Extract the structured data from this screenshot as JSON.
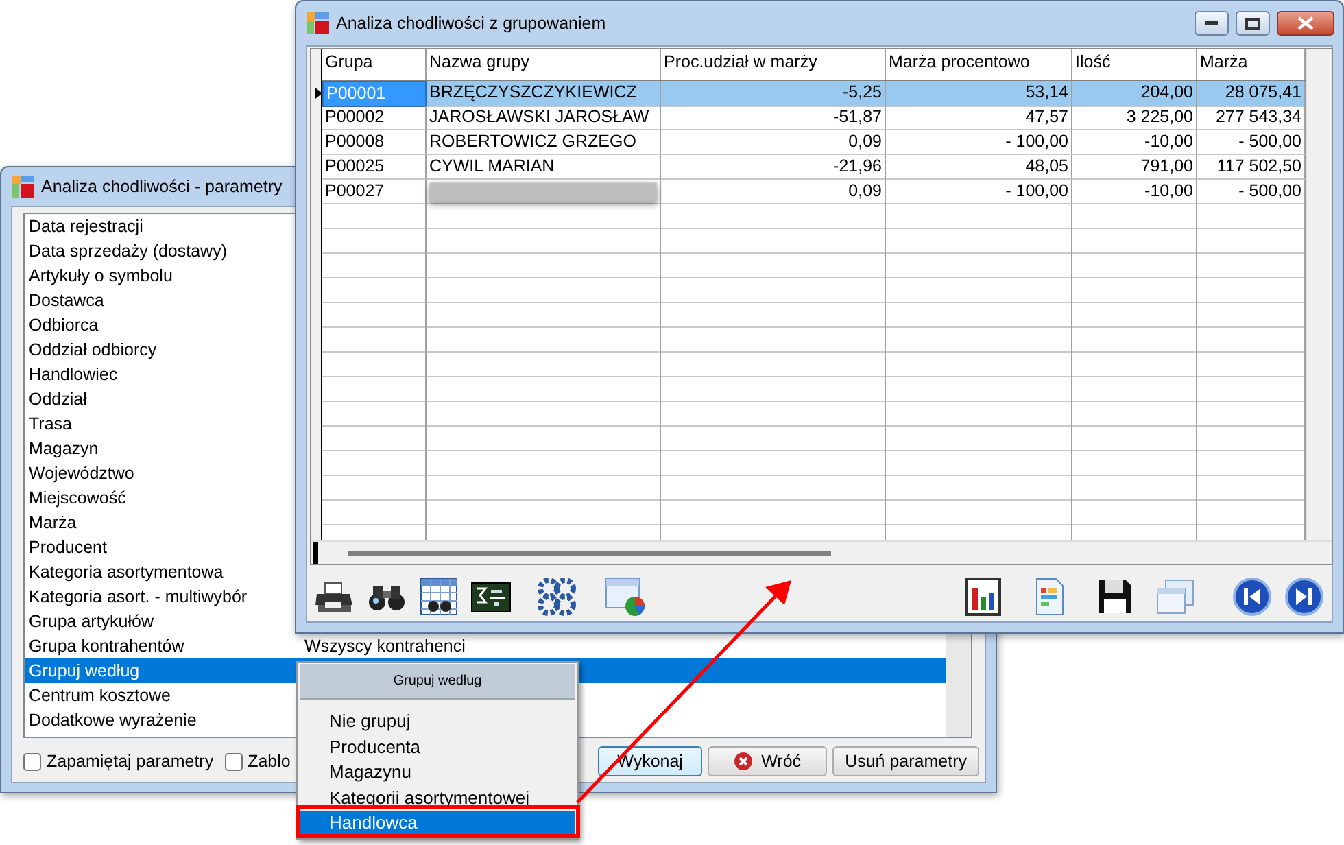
{
  "parameters_window": {
    "title": "Analiza chodliwości - parametry",
    "parameters": [
      {
        "label": "Data rejestracji",
        "selected": false
      },
      {
        "label": "Data sprzedaży (dostawy)",
        "selected": false
      },
      {
        "label": "Artykuły o symbolu",
        "selected": false
      },
      {
        "label": "Dostawca",
        "selected": false
      },
      {
        "label": "Odbiorca",
        "selected": false
      },
      {
        "label": "Oddział odbiorcy",
        "selected": false
      },
      {
        "label": "Handlowiec",
        "selected": false
      },
      {
        "label": "Oddział",
        "selected": false
      },
      {
        "label": "Trasa",
        "selected": false
      },
      {
        "label": "Magazyn",
        "selected": false
      },
      {
        "label": "Województwo",
        "selected": false
      },
      {
        "label": "Miejscowość",
        "selected": false
      },
      {
        "label": "Marża",
        "selected": false
      },
      {
        "label": "Producent",
        "selected": false
      },
      {
        "label": "Kategoria asortymentowa",
        "selected": false
      },
      {
        "label": "Kategoria asort. - multiwybór",
        "selected": false
      },
      {
        "label": "Grupa artykułów",
        "selected": false
      },
      {
        "label": "Grupa kontrahentów",
        "value": "Wszyscy kontrahenci",
        "selected": false
      },
      {
        "label": "Grupuj według",
        "selected": true
      },
      {
        "label": "Centrum kosztowe",
        "selected": false
      },
      {
        "label": "Dodatkowe wyrażenie",
        "selected": false
      }
    ],
    "options": [
      {
        "label": "Zapamiętaj parametry",
        "checked": false
      },
      {
        "label": "Zablo",
        "checked": false
      }
    ],
    "buttons": [
      {
        "label": "Wykonaj",
        "kind": "default"
      },
      {
        "label": "Wróć",
        "kind": "cancel"
      },
      {
        "label": "Usuń parametry",
        "kind": "plain"
      }
    ]
  },
  "grid_window": {
    "title": "Analiza chodliwości z grupowaniem",
    "columns": [
      "Grupa",
      "Nazwa grupy",
      "Proc.udział w marży",
      "Marża procentowo",
      "Ilość",
      "Marża"
    ],
    "rows": [
      {
        "cells": [
          "P00001",
          "BRZĘCZYSZCZYKIEWICZ",
          "-5,25",
          "53,14",
          "204,00",
          "28 075,41"
        ],
        "selected": true,
        "name_hidden": false
      },
      {
        "cells": [
          "P00002",
          "JAROSŁAWSKI JAROSŁAW",
          "-51,87",
          "47,57",
          "3 225,00",
          "277 543,34"
        ],
        "selected": false,
        "name_hidden": false
      },
      {
        "cells": [
          "P00008",
          "ROBERTOWICZ GRZEGO",
          "0,09",
          "- 100,00",
          "-10,00",
          "- 500,00"
        ],
        "selected": false,
        "name_hidden": false
      },
      {
        "cells": [
          "P00025",
          "CYWIL MARIAN",
          "-21,96",
          "48,05",
          "791,00",
          "117 502,50"
        ],
        "selected": false,
        "name_hidden": false
      },
      {
        "cells": [
          "P00027",
          "",
          "0,09",
          "- 100,00",
          "-10,00",
          "- 500,00"
        ],
        "selected": false,
        "name_hidden": true
      }
    ]
  },
  "dropdown": {
    "title": "Grupuj według",
    "items": [
      {
        "label": "Nie grupuj",
        "selected": false
      },
      {
        "label": "Producenta",
        "selected": false
      },
      {
        "label": "Magazynu",
        "selected": false
      },
      {
        "label": "Kategorii asortymentowej",
        "selected": false
      },
      {
        "label": "Handlowca",
        "selected": true
      }
    ]
  }
}
